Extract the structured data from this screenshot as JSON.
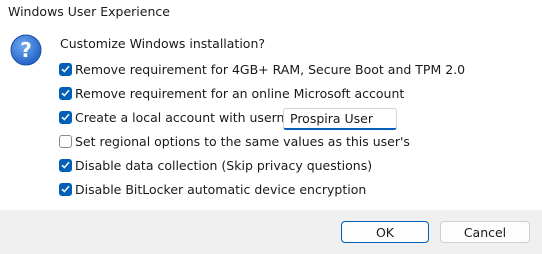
{
  "window": {
    "title": "Windows User Experience"
  },
  "dialog": {
    "icon": "question-icon",
    "prompt": "Customize Windows installation?"
  },
  "options": [
    {
      "label": "Remove requirement for 4GB+ RAM, Secure Boot and TPM 2.0",
      "checked": true
    },
    {
      "label": "Remove requirement for an online Microsoft account",
      "checked": true
    },
    {
      "label": "Create a local account with username:",
      "checked": true
    },
    {
      "label": "Set regional options to the same values as this user's",
      "checked": false
    },
    {
      "label": "Disable data collection (Skip privacy questions)",
      "checked": true
    },
    {
      "label": "Disable BitLocker automatic device encryption",
      "checked": true
    }
  ],
  "username": {
    "value": "Prospira User",
    "placeholder": ""
  },
  "buttons": {
    "ok": "OK",
    "cancel": "Cancel"
  },
  "colors": {
    "accent": "#005fb8",
    "footer_bg": "#f0f0f0",
    "icon_blue": "#2b6fd6"
  }
}
